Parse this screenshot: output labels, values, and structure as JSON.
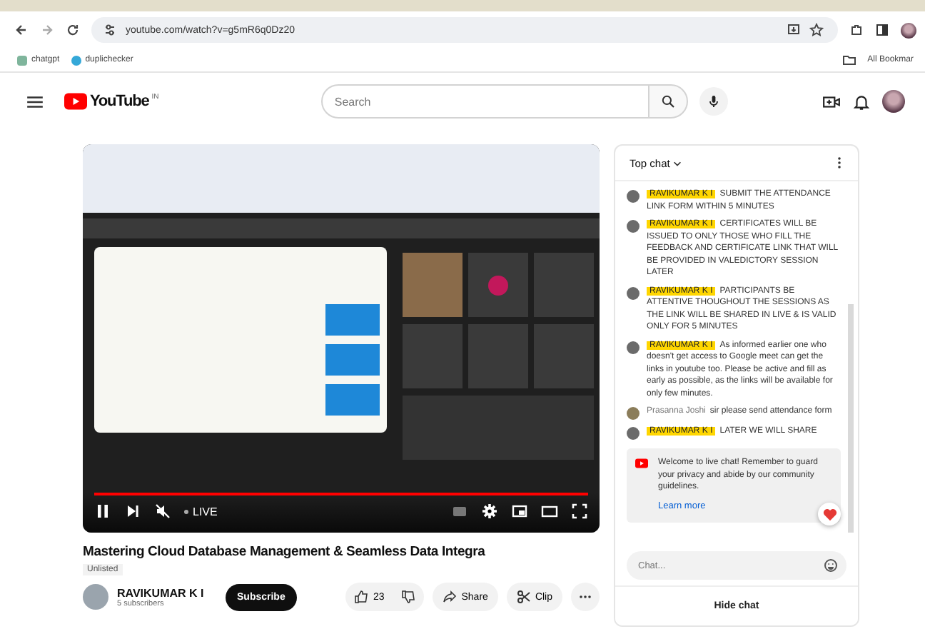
{
  "browser": {
    "url": "youtube.com/watch?v=g5mR6q0Dz20",
    "bookmarks": [
      "chatgpt",
      "duplichecker"
    ],
    "all_bookmarks": "All Bookmar"
  },
  "header": {
    "logo": "YouTube",
    "region": "IN",
    "search": {
      "placeholder": "Search"
    }
  },
  "player": {
    "progress": {
      "level": 1
    },
    "live": "LIVE",
    "muted": true
  },
  "video": {
    "title": "Mastering Cloud Database Management & Seamless Data Integra",
    "visibility": "Unlisted",
    "channel": {
      "name": "RAVIKUMAR K I",
      "subscribers": "5 subscribers"
    },
    "subscribe": "Subscribe",
    "likes": "23",
    "share": "Share",
    "clip": "Clip"
  },
  "chat": {
    "title": "Top chat",
    "messages": [
      {
        "author": "RAVIKUMAR K I",
        "text": "SUBMIT THE ATTENDANCE LINK FORM WITHIN 5 MINUTES",
        "owner": true
      },
      {
        "author": "RAVIKUMAR K I",
        "text": "CERTIFICATES WILL BE ISSUED TO ONLY THOSE WHO FILL THE FEEDBACK AND CERTIFICATE LINK THAT WILL BE PROVIDED IN VALEDICTORY SESSION LATER",
        "owner": true
      },
      {
        "author": "RAVIKUMAR K I",
        "text": "PARTICIPANTS BE ATTENTIVE THOUGHOUT THE SESSIONS AS THE LINK WILL BE SHARED IN LIVE & IS VALID ONLY FOR 5 MINUTES",
        "owner": true
      },
      {
        "author": "RAVIKUMAR K I",
        "text": "As informed earlier one who doesn't get access to Google meet can get the links in youtube too. Please be active and fill as early as possible, as the links will be available for only few minutes.",
        "owner": true
      },
      {
        "author": "Prasanna Joshi",
        "text": "sir please send attendance form",
        "owner": false
      },
      {
        "author": "RAVIKUMAR K I",
        "text": "LATER WE WILL SHARE",
        "owner": true
      }
    ],
    "welcome": {
      "text": "Welcome to live chat! Remember to guard your privacy and abide by our community guidelines.",
      "link": "Learn more"
    },
    "input": {
      "placeholder": "Chat..."
    },
    "hide": "Hide chat"
  }
}
